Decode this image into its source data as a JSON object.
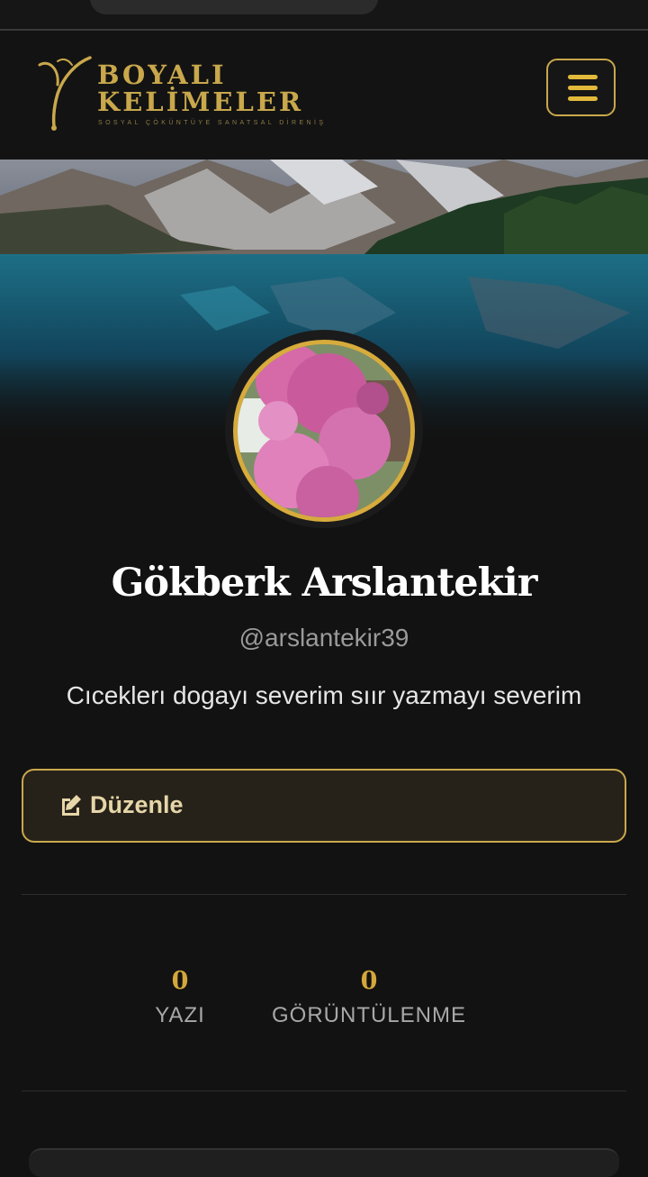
{
  "header": {
    "logo_line1": "BOYALI",
    "logo_line2": "KELİMELER",
    "logo_tagline": "SOSYAL ÇÖKÜNTÜYE SANATSAL DİRENİŞ",
    "menu_icon": "hamburger-menu-icon"
  },
  "profile": {
    "name": "Gökberk Arslantekir",
    "handle": "@arslantekir39",
    "bio": "Cıceklerı dogayı severim sıır yazmayı severim",
    "edit_label": "Düzenle",
    "edit_icon": "edit-icon"
  },
  "stats": [
    {
      "value": "0",
      "label": "YAZI"
    },
    {
      "value": "0",
      "label": "GÖRÜNTÜLENME"
    }
  ],
  "colors": {
    "accent_gold": "#c9a84c",
    "background": "#121212",
    "button_bg": "#272219"
  }
}
